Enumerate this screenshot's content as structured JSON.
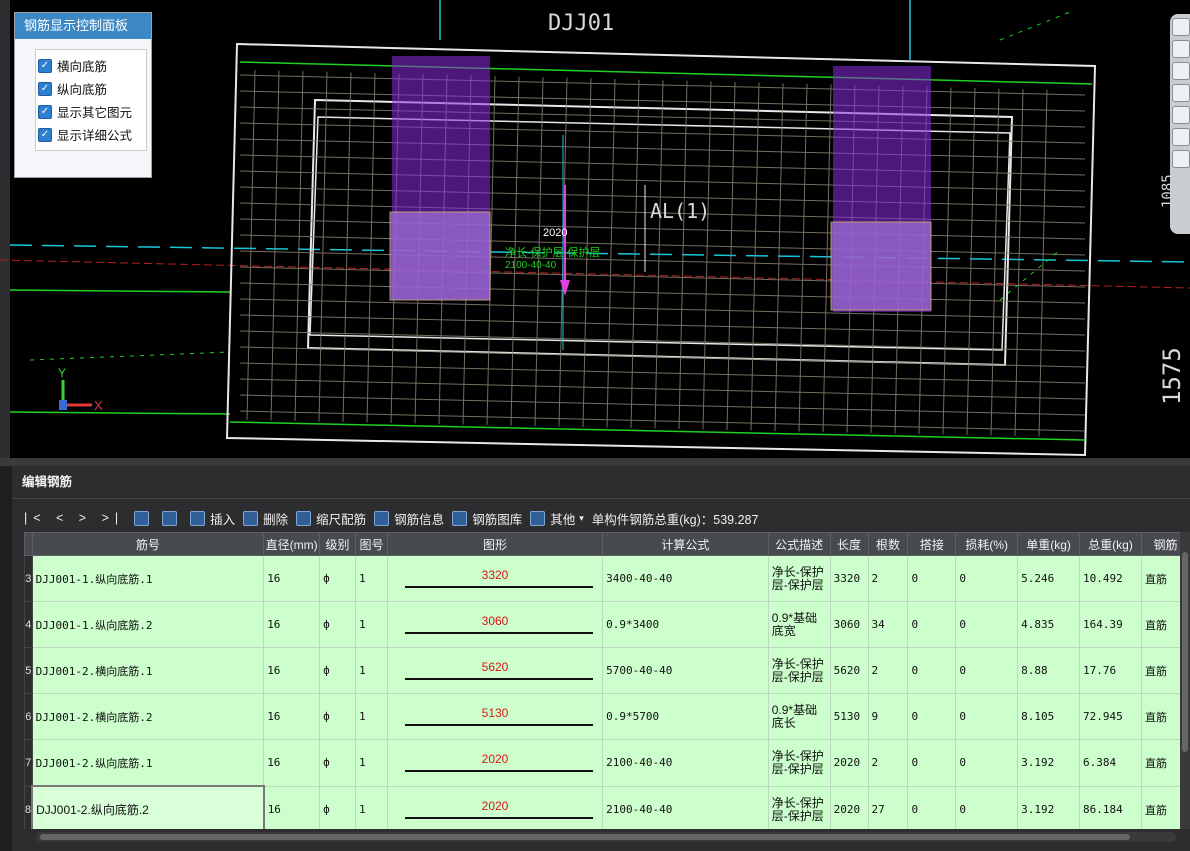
{
  "cad": {
    "element_label": "DJJ01",
    "beam_label": "AL(1)",
    "dim_top": "2020",
    "dim_note": "净长-保护层-保护层",
    "dim_sub": "2100-40-40",
    "side_dim": "1575",
    "side_dim_top": "1085",
    "axis_x": "X",
    "axis_y": "Y"
  },
  "control_panel": {
    "title": "钢筋显示控制面板",
    "options": [
      {
        "label": "横向底筋",
        "checked": true
      },
      {
        "label": "纵向底筋",
        "checked": true
      },
      {
        "label": "显示其它图元",
        "checked": true
      },
      {
        "label": "显示详细公式",
        "checked": true
      }
    ]
  },
  "editor": {
    "title": "编辑钢筋",
    "nav": "|< < > >|",
    "toolbar": {
      "insert": "插入",
      "delete": "删除",
      "scale": "缩尺配筋",
      "info": "钢筋信息",
      "library": "钢筋图库",
      "other": "其他",
      "total_weight": "单构件钢筋总重(kg)：539.287"
    },
    "columns": [
      "筋号",
      "直径(mm)",
      "级别",
      "图号",
      "图形",
      "计算公式",
      "公式描述",
      "长度",
      "根数",
      "搭接",
      "损耗(%)",
      "单重(kg)",
      "总重(kg)",
      "钢筋"
    ],
    "rows": [
      {
        "rn": "3",
        "name": "DJJ001-1.纵向底筋.1",
        "dia": "16",
        "grade": "ф",
        "fig": "1",
        "shape": "3320",
        "formula": "3400-40-40",
        "desc": "净长-保护层-保护层",
        "len": "3320",
        "count": "2",
        "lap": "0",
        "loss": "0",
        "unit": "5.246",
        "total": "10.492",
        "type": "直筋"
      },
      {
        "rn": "4",
        "name": "DJJ001-1.纵向底筋.2",
        "dia": "16",
        "grade": "ф",
        "fig": "1",
        "shape": "3060",
        "formula": "0.9*3400",
        "desc": "0.9*基础底宽",
        "len": "3060",
        "count": "34",
        "lap": "0",
        "loss": "0",
        "unit": "4.835",
        "total": "164.39",
        "type": "直筋"
      },
      {
        "rn": "5",
        "name": "DJJ001-2.横向底筋.1",
        "dia": "16",
        "grade": "ф",
        "fig": "1",
        "shape": "5620",
        "formula": "5700-40-40",
        "desc": "净长-保护层-保护层",
        "len": "5620",
        "count": "2",
        "lap": "0",
        "loss": "0",
        "unit": "8.88",
        "total": "17.76",
        "type": "直筋"
      },
      {
        "rn": "6",
        "name": "DJJ001-2.横向底筋.2",
        "dia": "16",
        "grade": "ф",
        "fig": "1",
        "shape": "5130",
        "formula": "0.9*5700",
        "desc": "0.9*基础底长",
        "len": "5130",
        "count": "9",
        "lap": "0",
        "loss": "0",
        "unit": "8.105",
        "total": "72.945",
        "type": "直筋"
      },
      {
        "rn": "7",
        "name": "DJJ001-2.纵向底筋.1",
        "dia": "16",
        "grade": "ф",
        "fig": "1",
        "shape": "2020",
        "formula": "2100-40-40",
        "desc": "净长-保护层-保护层",
        "len": "2020",
        "count": "2",
        "lap": "0",
        "loss": "0",
        "unit": "3.192",
        "total": "6.384",
        "type": "直筋"
      },
      {
        "rn": "8",
        "name": "DJJ001-2.纵向底筋.2",
        "dia": "16",
        "grade": "ф",
        "fig": "1",
        "shape": "2020",
        "formula": "2100-40-40",
        "desc": "净长-保护层-保护层",
        "len": "2020",
        "count": "27",
        "lap": "0",
        "loss": "0",
        "unit": "3.192",
        "total": "86.184",
        "type": "直筋"
      }
    ]
  }
}
